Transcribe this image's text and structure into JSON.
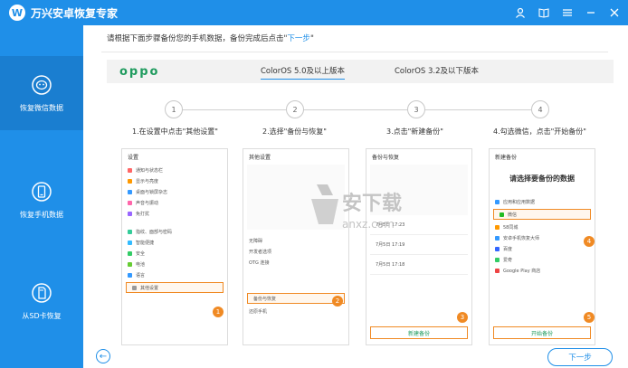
{
  "app": {
    "title": "万兴安卓恢复专家",
    "logo_char": "W"
  },
  "window_controls": [
    "user-icon",
    "book-icon",
    "menu-icon",
    "minimize-icon",
    "close-icon"
  ],
  "sidebar": {
    "items": [
      {
        "label": "恢复微信数据",
        "icon": "wechat-recover-icon",
        "active": true
      },
      {
        "label": "恢复手机数据",
        "icon": "phone-recover-icon",
        "active": false
      },
      {
        "label": "从SD卡恢复",
        "icon": "sdcard-icon",
        "active": false
      }
    ]
  },
  "main": {
    "instruction_prefix": "请根据下面步骤备份您的手机数据，备份完成后点击\"",
    "instruction_link": "下一步",
    "instruction_suffix": "\"",
    "brand": "oppo",
    "tabs": [
      {
        "label": "ColorOS 5.0及以上版本",
        "active": true
      },
      {
        "label": "ColorOS 3.2及以下版本",
        "active": false
      }
    ],
    "steps": [
      {
        "num": "1",
        "label": "1.在设置中点击\"其他设置\""
      },
      {
        "num": "2",
        "label": "2.选择\"备份与恢复\""
      },
      {
        "num": "3",
        "label": "3.点击\"新建备份\""
      },
      {
        "num": "4",
        "label": "4.勾选微信，点击\"开始备份\""
      }
    ],
    "phone1": {
      "header": "设置",
      "rows": [
        "通知与状态栏",
        "显示与亮度",
        "桌面与锁屏杂志",
        "声音与振动",
        "免打扰",
        "指纹、面部与密码",
        "智能便捷",
        "安全",
        "电池",
        "语言",
        "其他设置"
      ],
      "badge": "1"
    },
    "phone2": {
      "header": "其他设置",
      "rows": [
        "无障碍",
        "开发者选项",
        "OTG 连接",
        "备份与恢复",
        "还原手机"
      ],
      "badge": "2"
    },
    "phone3": {
      "header": "备份与恢复",
      "rows": [
        "7月5日 17:23",
        "7月5日 17:19",
        "7月5日 17:18"
      ],
      "button": "新建备份",
      "badge": "3"
    },
    "phone4": {
      "header": "新建备份",
      "title": "请选择要备份的数据",
      "rows": [
        "应用和应用数据",
        "微信",
        "58同城",
        "安卓手机恢复大师",
        "百度",
        "爱奇",
        "Google Play 商店"
      ],
      "button": "开始备份",
      "badges": [
        "4",
        "5"
      ]
    },
    "watermark": "anxz.com",
    "back_icon": "back-arrow-icon",
    "next_label": "下一步"
  },
  "colors": {
    "primary": "#1f8fe8",
    "orange": "#f08a24",
    "green": "#1f9b5e"
  }
}
